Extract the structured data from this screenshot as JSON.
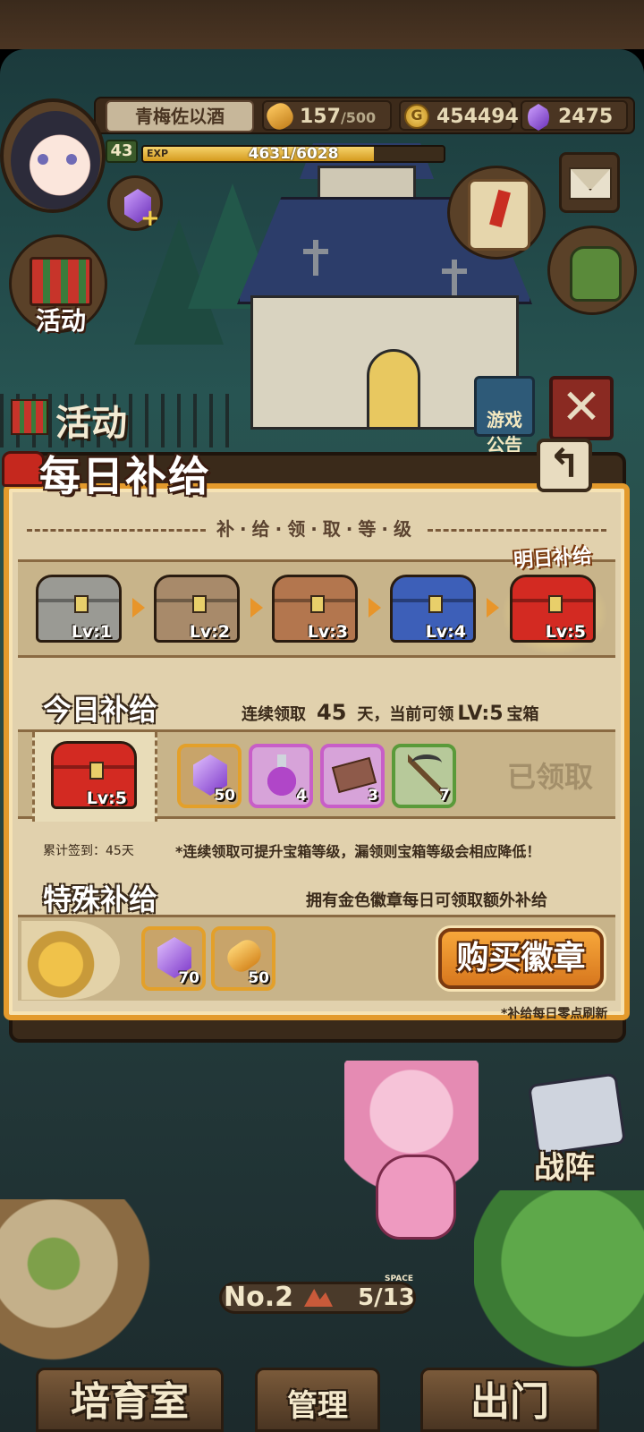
{
  "player": {
    "name": "青梅佐以酒",
    "level": "43",
    "exp_label": "EXP",
    "exp_text": "4631/6028",
    "exp_fraction": 0.768
  },
  "resources": {
    "bread": "157",
    "bread_max": "/500",
    "coins_symbol": "G",
    "coins": "454494",
    "gems": "2475"
  },
  "side_buttons": {
    "event_label": "活动",
    "notice_label": "游戏\n公告"
  },
  "activity_tab": "活动",
  "panel": {
    "title": "每日补给",
    "back_symbol": "↰",
    "section_header": "补·给·领·取·等·级",
    "tomorrow_label": "明日补给",
    "chest_levels": [
      "Lv:1",
      "Lv:2",
      "Lv:3",
      "Lv:4",
      "Lv:5"
    ],
    "chest_colors": [
      "#9a9a94",
      "#a88a6a",
      "#b3764e",
      "#3d5fb8",
      "#d32a22"
    ],
    "today": {
      "title": "今日补给",
      "streak_prefix": "连续领取",
      "streak_days": "45",
      "streak_middle": "天，当前可领",
      "streak_level": "LV:5",
      "streak_suffix": "宝箱",
      "chest_level": "Lv:5",
      "items": [
        {
          "icon": "purple-gem",
          "qty": "50",
          "rarity": "gold"
        },
        {
          "icon": "purple-potion",
          "qty": "4",
          "rarity": "purple"
        },
        {
          "icon": "ticket",
          "qty": "3",
          "rarity": "purple"
        },
        {
          "icon": "pickaxe",
          "qty": "7",
          "rarity": "green"
        }
      ],
      "claimed_label": "已领取"
    },
    "total_days": "累计签到：45天",
    "tip": "*连续领取可提升宝箱等级，漏领则宝箱等级会相应降低！",
    "special": {
      "title": "特殊补给",
      "description": "拥有金色徽章每日可领取额外补给",
      "items": [
        {
          "icon": "purple-gem",
          "qty": "70"
        },
        {
          "icon": "bread",
          "qty": "50"
        }
      ],
      "buy_label": "购买徽章"
    },
    "refresh_note": "*补给每日零点刷新"
  },
  "bottom": {
    "formation_label": "战阵",
    "no_prefix": "No.",
    "no_value": "2",
    "space_label": "SPACE",
    "space_count": "5/13",
    "nav": [
      "培育室",
      "管理",
      "出门"
    ]
  }
}
